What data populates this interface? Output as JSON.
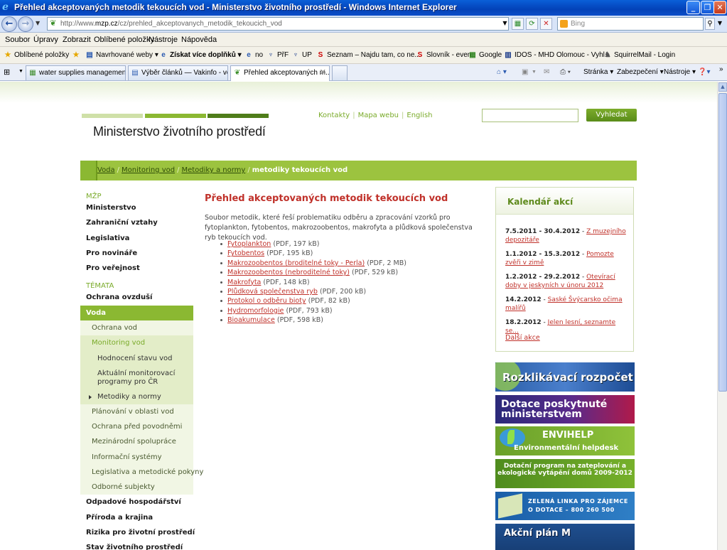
{
  "window": {
    "title": "Přehled akceptovaných metodik tekoucích vod - Ministerstvo životního prostředí - Windows Internet Explorer",
    "address": "http://www.mzp.cz/cz/prehled_akceptovanych_metodik_tekoucich_vod",
    "address_host": "mzp.cz",
    "search_placeholder": "Bing"
  },
  "menu": [
    "Soubor",
    "Úpravy",
    "Zobrazit",
    "Oblíbené položky",
    "Nástroje",
    "Nápověda"
  ],
  "favorites_bar": {
    "favorites": "Oblíbené položky",
    "suggested": "Navrhované weby ▾",
    "addons": "Získat více doplňků ▾",
    "items": [
      "no",
      "PřF",
      "UP",
      "Seznam – Najdu tam, co ne...",
      "Slovník - even",
      "Google",
      "IDOS - MHD Olomouc - Vyhl...",
      "SquirrelMail - Login"
    ]
  },
  "tabs": [
    {
      "label": "water supplies management ..."
    },
    {
      "label": "Výběr článků — Vakinfo - vod..."
    },
    {
      "label": "Přehled akceptovaných m..."
    }
  ],
  "commandbar": {
    "page": "Stránka ▾",
    "security": "Zabezpečení ▾",
    "tools": "Nástroje ▾"
  },
  "site": {
    "logo": "Ministerstvo životního prostředí",
    "toplinks": [
      "Kontakty",
      "Mapa webu",
      "English"
    ],
    "search_button": "Vyhledat",
    "colors": {
      "green": "#8bb832",
      "red": "#c0312a"
    }
  },
  "breadcrumb": {
    "links": [
      "Voda",
      "Monitoring vod",
      "Metodiky a normy"
    ],
    "current": "metodiky tekoucích vod",
    "separator": "/"
  },
  "leftnav": {
    "header_mzp": "MŽP",
    "mzp_items": [
      "Ministerstvo",
      "Zahraniční vztahy",
      "Legislativa",
      "Pro novináře",
      "Pro veřejnost"
    ],
    "header_temata": "TÉMATA",
    "ovzdusi": "Ochrana ovzduší",
    "voda": "Voda",
    "voda_sub_first": "Ochrana vod",
    "monitoring": "Monitoring vod",
    "monitoring_sub": [
      "Hodnocení stavu vod",
      "Aktuální monitorovací programy pro ČR",
      "Metodiky a normy"
    ],
    "voda_sub_rest": [
      "Plánování v oblasti vod",
      "Ochrana před povodněmi",
      "Mezinárodní spolupráce",
      "Informační systémy",
      "Legislativa a metodické pokyny",
      "Odborné subjekty"
    ],
    "after": [
      "Odpadové hospodářství",
      "Příroda a krajina",
      "Rizika pro životní prostředí",
      "Stav životního prostředí"
    ]
  },
  "main": {
    "title": "Přehled akceptovaných metodik tekoucích vod",
    "intro": "Soubor metodik, které řeší problematiku odběru a zpracování vzorků pro fytoplankton, fytobentos, makrozoobentos, makrofyta a plůdková společenstva ryb tekoucích vod.",
    "documents": [
      {
        "name": "Fytoplankton",
        "info": "(PDF, 197 kB)"
      },
      {
        "name": "Fytobentos",
        "info": "(PDF, 195 kB)"
      },
      {
        "name": "Makrozoobentos (broditelné toky - Perla)",
        "info": "(PDF, 2 MB)"
      },
      {
        "name": "Makrozoobentos (nebroditelné toky)",
        "info": "(PDF, 529 kB)"
      },
      {
        "name": "Makrofyta",
        "info": "(PDF, 148 kB)"
      },
      {
        "name": "Plůdková společenstva ryb",
        "info": "(PDF, 200 kB)"
      },
      {
        "name": "Protokol o odběru bioty",
        "info": "(PDF, 82 kB)"
      },
      {
        "name": "Hydromorfologie",
        "info": "(PDF, 793 kB)"
      },
      {
        "name": "Bioakumulace",
        "info": "(PDF, 598 kB)"
      }
    ]
  },
  "calendar": {
    "title": "Kalendář akcí",
    "events": [
      {
        "date": "7.5.2011 - 30.4.2012",
        "link": "Z muzejního depozitáře"
      },
      {
        "date": "1.1.2012 - 15.3.2012",
        "link": "Pomozte zvěři v zimě"
      },
      {
        "date": "1.2.2012 - 29.2.2012",
        "link": "Otevírací doby v jeskyních v únoru 2012"
      },
      {
        "date": "14.2.2012",
        "link": "Saské Švýcarsko očima malířů"
      },
      {
        "date": "18.2.2012",
        "link": "Jelen lesní, seznamte se..."
      }
    ],
    "more": "Další akce"
  },
  "banners": {
    "rozpocet": "Rozklikávací rozpočet",
    "dotace": "Dotace poskytnuté ministerstvem",
    "envihelp_title": "ENVIHELP",
    "envihelp_sub": "Environmentální helpdesk",
    "zatepleni": "Dotační program na zateplování a ekologické vytápění domů 2009-2012",
    "linka_1": "ZELENÁ LINKA PRO ZÁJEMCE",
    "linka_2": "O DOTACE – 800 260 500",
    "akcni": "Akční plán M"
  }
}
